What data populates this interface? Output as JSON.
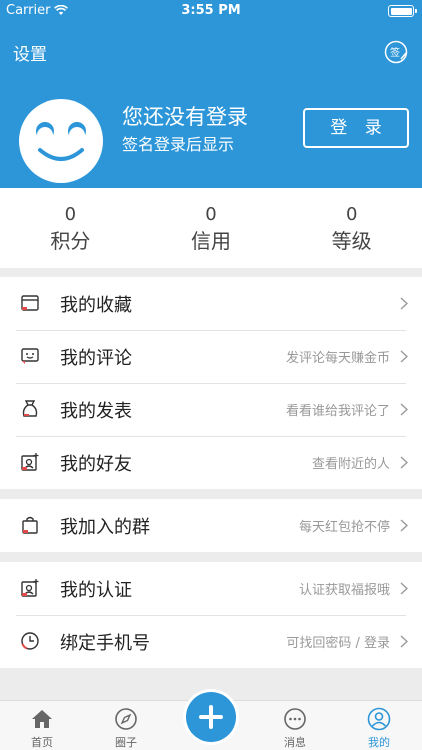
{
  "status_bar": {
    "carrier": "Carrier",
    "time": "3:55 PM"
  },
  "header": {
    "settings_label": "设置",
    "sign_icon": "sign-in-calendar-icon",
    "user_name": "您还没有登录",
    "user_sub": "签名登录后显示",
    "login_label": "登 录",
    "accent_color": "#2d96d8"
  },
  "stats": [
    {
      "value": "0",
      "label": "积分"
    },
    {
      "value": "0",
      "label": "信用"
    },
    {
      "value": "0",
      "label": "等级"
    }
  ],
  "menu": [
    {
      "label": "我的收藏",
      "hint": "",
      "icon": "folder-icon"
    },
    {
      "label": "我的评论",
      "hint": "发评论每天赚金币",
      "icon": "comment-icon"
    },
    {
      "label": "我的发表",
      "hint": "看看谁给我评论了",
      "icon": "bag-icon"
    },
    {
      "label": "我的好友",
      "hint": "查看附近的人",
      "icon": "contact-add-icon"
    },
    {
      "label": "我加入的群",
      "hint": "每天红包抢不停",
      "icon": "group-bag-icon"
    },
    {
      "label": "我的认证",
      "hint": "认证获取福报哦",
      "icon": "certificate-icon"
    },
    {
      "label": "绑定手机号",
      "hint": "可找回密码 / 登录",
      "icon": "clock-icon"
    }
  ],
  "tabbar": [
    {
      "label": "首页",
      "icon": "home-icon"
    },
    {
      "label": "圈子",
      "icon": "compass-icon"
    },
    {
      "label": "消息",
      "icon": "message-icon"
    },
    {
      "label": "我的",
      "icon": "profile-icon"
    }
  ]
}
